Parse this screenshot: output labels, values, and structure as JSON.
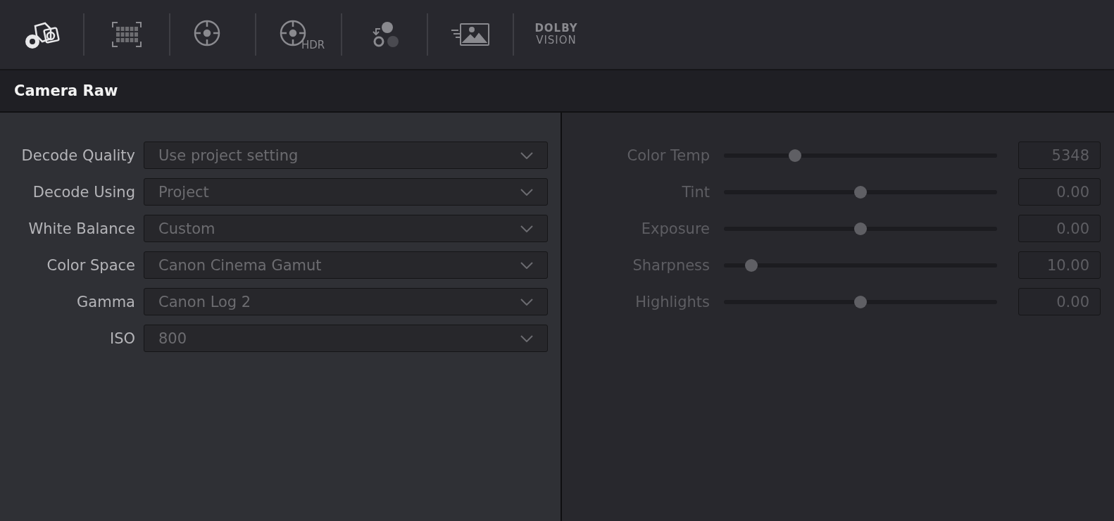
{
  "toolbar": [
    {
      "kind": "camera-raw",
      "selected": true
    },
    {
      "kind": "color-chart",
      "selected": false
    },
    {
      "kind": "target",
      "selected": false
    },
    {
      "kind": "hdr",
      "selected": false,
      "label": "HDR"
    },
    {
      "kind": "color-circles",
      "selected": false
    },
    {
      "kind": "motion-picture",
      "selected": false
    },
    {
      "kind": "dolby",
      "selected": false,
      "label": "DOLBY",
      "sublabel": "VISION"
    }
  ],
  "panel_title": "Camera Raw",
  "settings": [
    {
      "label": "Decode Quality",
      "value": "Use project setting"
    },
    {
      "label": "Decode Using",
      "value": "Project"
    },
    {
      "label": "White Balance",
      "value": "Custom"
    },
    {
      "label": "Color Space",
      "value": "Canon Cinema Gamut"
    },
    {
      "label": "Gamma",
      "value": "Canon Log 2"
    },
    {
      "label": "ISO",
      "value": "800"
    }
  ],
  "adjustments": [
    {
      "label": "Color Temp",
      "level": 0.26,
      "value": "5348"
    },
    {
      "label": "Tint",
      "level": 0.5,
      "value": "0.00"
    },
    {
      "label": "Exposure",
      "level": 0.5,
      "value": "0.00"
    },
    {
      "label": "Sharpness",
      "level": 0.1,
      "value": "10.00"
    },
    {
      "label": "Highlights",
      "level": 0.5,
      "value": "0.00"
    }
  ]
}
